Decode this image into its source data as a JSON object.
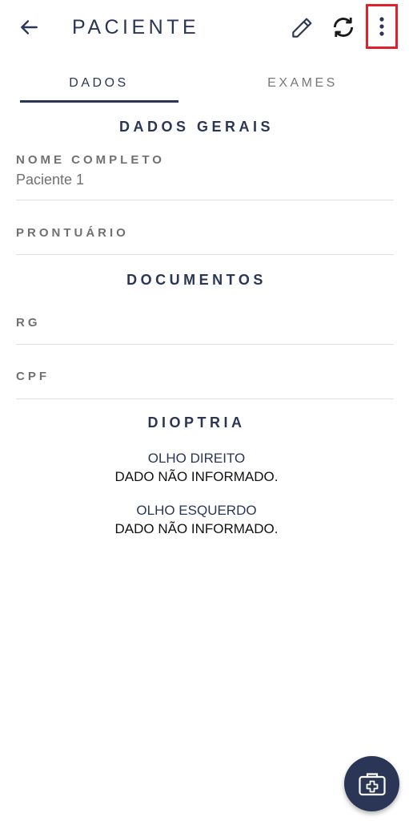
{
  "header": {
    "title": "PACIENTE",
    "back_icon": "arrow-back-icon",
    "edit_icon": "pencil-icon",
    "sync_icon": "sync-icon",
    "more_icon": "more-vertical-icon"
  },
  "tabs": [
    {
      "label": "DADOS",
      "selected": true
    },
    {
      "label": "EXAMES",
      "selected": false
    }
  ],
  "sections": {
    "dados_gerais": {
      "title": "DADOS GERAIS",
      "nome_label": "NOME COMPLETO",
      "nome_value": "Paciente 1",
      "prontuario_label": "PRONTUÁRIO",
      "prontuario_value": ""
    },
    "documentos": {
      "title": "DOCUMENTOS",
      "rg_label": "RG",
      "rg_value": "",
      "cpf_label": "CPF",
      "cpf_value": ""
    },
    "dioptria": {
      "title": "DIOPTRIA",
      "olho_direito_label": "OLHO DIREITO",
      "olho_direito_value": "DADO NÃO INFORMADO.",
      "olho_esquerdo_label": "OLHO ESQUERDO",
      "olho_esquerdo_value": "DADO NÃO INFORMADO."
    }
  },
  "fab": {
    "icon": "medical-kit-icon"
  },
  "colors": {
    "primary": "#2b3656",
    "muted": "#707070",
    "highlight": "#e0202a"
  }
}
